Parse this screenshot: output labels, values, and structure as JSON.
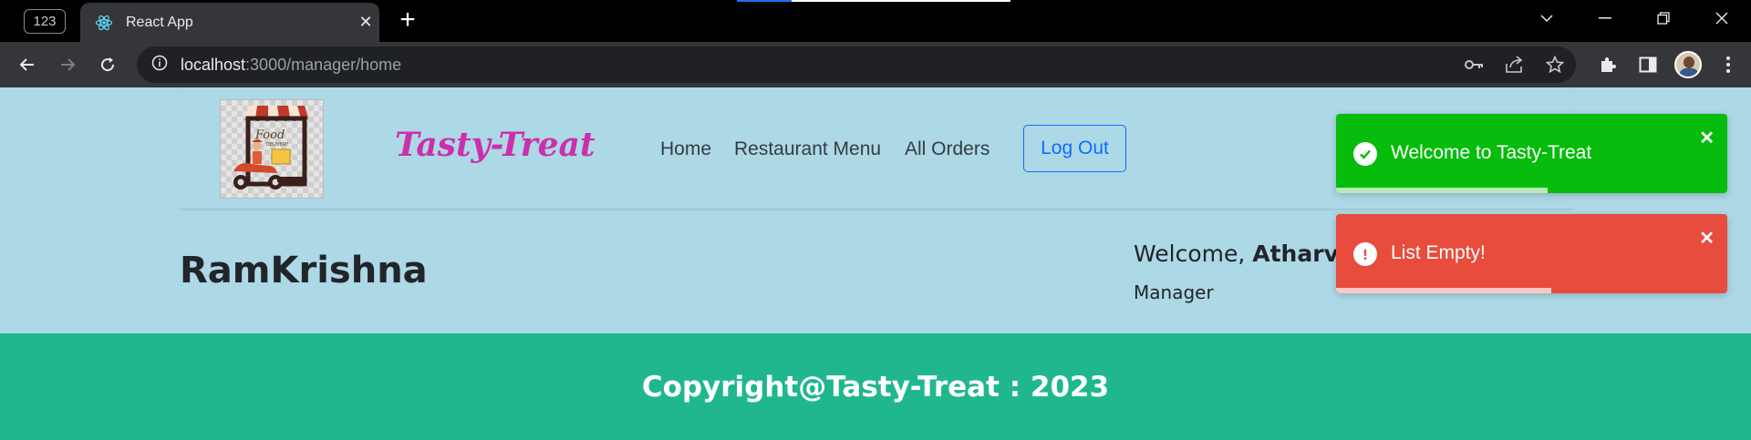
{
  "browser": {
    "tab_count": "123",
    "tab_title": "React App",
    "tab_close": "✕",
    "new_tab": "+",
    "url_host": "localhost",
    "url_path": ":3000/manager/home"
  },
  "navbar": {
    "brand": "Tasty-Treat",
    "links": [
      "Home",
      "Restaurant Menu",
      "All Orders"
    ],
    "logout_label": "Log Out"
  },
  "main": {
    "restaurant_name": "RamKrishna",
    "welcome_prefix": "Welcome, ",
    "user_name": "Atharva",
    "role": "Manager"
  },
  "footer": {
    "text": "Copyright@Tasty-Treat : 2023"
  },
  "toasts": [
    {
      "type": "success",
      "message": "Welcome to Tasty-Treat",
      "progress": 0.54,
      "color": "#07bc0c"
    },
    {
      "type": "error",
      "message": "List Empty!",
      "progress": 0.55,
      "color": "#e74c3c"
    }
  ],
  "colors": {
    "page_bg": "#add8e6",
    "brand": "#cc2faa",
    "footer_bg": "#20b78f",
    "link_accent": "#0d6efd"
  }
}
